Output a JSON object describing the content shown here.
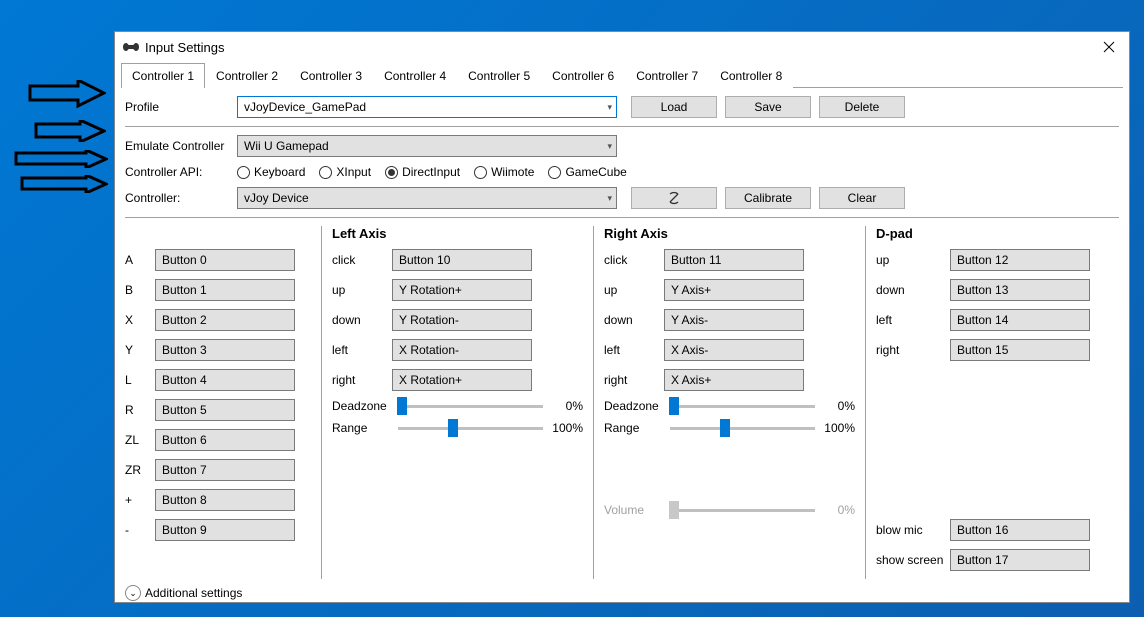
{
  "window": {
    "title": "Input Settings"
  },
  "tabs": [
    "Controller 1",
    "Controller 2",
    "Controller 3",
    "Controller 4",
    "Controller 5",
    "Controller 6",
    "Controller 7",
    "Controller 8"
  ],
  "activeTab": 0,
  "profile": {
    "label": "Profile",
    "value": "vJoyDevice_GamePad",
    "load": "Load",
    "save": "Save",
    "delete": "Delete"
  },
  "emulate": {
    "label": "Emulate Controller",
    "value": "Wii U Gamepad"
  },
  "api": {
    "label": "Controller API:",
    "options": [
      "Keyboard",
      "XInput",
      "DirectInput",
      "Wiimote",
      "GameCube"
    ],
    "selected": "DirectInput"
  },
  "controller": {
    "label": "Controller:",
    "value": "vJoy Device",
    "calibrate": "Calibrate",
    "clear": "Clear"
  },
  "buttons": {
    "items": [
      {
        "label": "A",
        "value": "Button 0"
      },
      {
        "label": "B",
        "value": "Button 1"
      },
      {
        "label": "X",
        "value": "Button 2"
      },
      {
        "label": "Y",
        "value": "Button 3"
      },
      {
        "label": "L",
        "value": "Button 4"
      },
      {
        "label": "R",
        "value": "Button 5"
      },
      {
        "label": "ZL",
        "value": "Button 6"
      },
      {
        "label": "ZR",
        "value": "Button 7"
      },
      {
        "label": "+",
        "value": "Button 8"
      },
      {
        "label": "-",
        "value": "Button 9"
      }
    ]
  },
  "leftAxis": {
    "title": "Left Axis",
    "items": [
      {
        "label": "click",
        "value": "Button 10"
      },
      {
        "label": "up",
        "value": "Y Rotation+"
      },
      {
        "label": "down",
        "value": "Y Rotation-"
      },
      {
        "label": "left",
        "value": "X Rotation-"
      },
      {
        "label": "right",
        "value": "X Rotation+"
      }
    ],
    "deadzone": {
      "label": "Deadzone",
      "value": "0%",
      "pos": 3
    },
    "range": {
      "label": "Range",
      "value": "100%",
      "pos": 38
    }
  },
  "rightAxis": {
    "title": "Right Axis",
    "items": [
      {
        "label": "click",
        "value": "Button 11"
      },
      {
        "label": "up",
        "value": "Y Axis+"
      },
      {
        "label": "down",
        "value": "Y Axis-"
      },
      {
        "label": "left",
        "value": "X Axis-"
      },
      {
        "label": "right",
        "value": "X Axis+"
      }
    ],
    "deadzone": {
      "label": "Deadzone",
      "value": "0%",
      "pos": 3
    },
    "range": {
      "label": "Range",
      "value": "100%",
      "pos": 38
    },
    "volume": {
      "label": "Volume",
      "value": "0%",
      "pos": 3
    }
  },
  "dpad": {
    "title": "D-pad",
    "items": [
      {
        "label": "up",
        "value": "Button 12"
      },
      {
        "label": "down",
        "value": "Button 13"
      },
      {
        "label": "left",
        "value": "Button 14"
      },
      {
        "label": "right",
        "value": "Button 15"
      }
    ],
    "extra": [
      {
        "label": "blow mic",
        "value": "Button 16"
      },
      {
        "label": "show screen",
        "value": "Button 17"
      }
    ]
  },
  "additional": "Additional settings"
}
